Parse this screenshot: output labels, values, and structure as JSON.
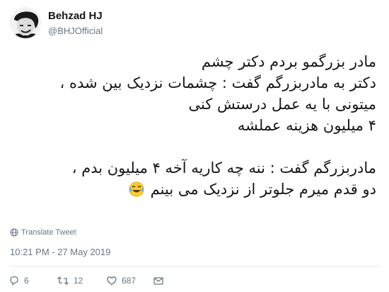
{
  "user": {
    "name": "Behzad HJ",
    "handle": "@BHJOfficial"
  },
  "tweet": {
    "lines": [
      "مادر بزرگمو بردم دکتر چشم",
      "دکتر به مادربزرگم گفت : چشمات نزدیک بین شده ،",
      "میتونی با یه عمل درستش کنی",
      "۴ میلیون هزینه عملشه",
      "",
      "مادربزرگم گفت : ننه چه کاریه آخه ۴ میلیون بدم ،",
      "دو قدم میرم جلوتر از نزدیک می بینم"
    ],
    "emoji": "face-with-tears-of-joy"
  },
  "translate_label": "Translate Tweet",
  "timestamp": "10:21 PM - 27 May 2019",
  "actions": {
    "reply_count": "6",
    "retweet_count": "12",
    "like_count": "687"
  },
  "colors": {
    "text": "#14171a",
    "secondary": "#657786",
    "divider": "#e6ecf0"
  }
}
